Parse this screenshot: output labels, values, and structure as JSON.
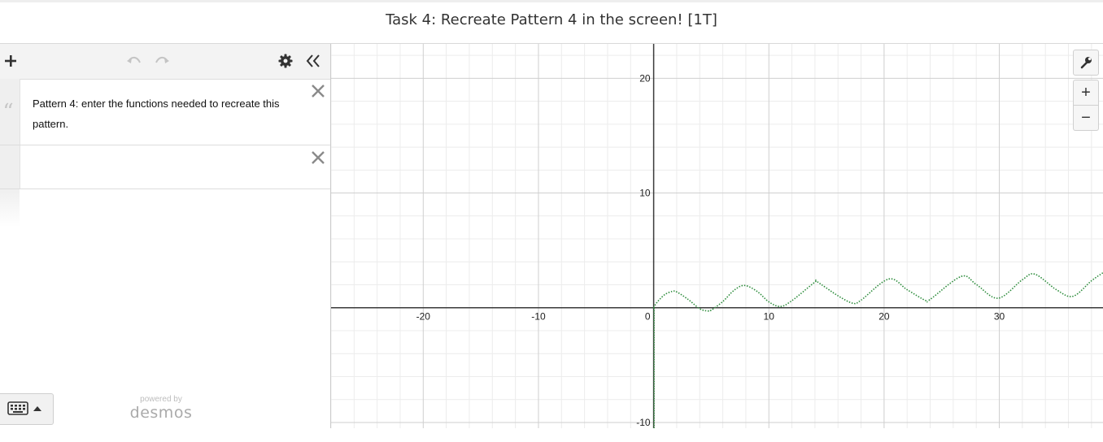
{
  "page": {
    "title": "Task 4: Recreate Pattern 4 in the screen! [1T]"
  },
  "toolbar": {
    "add_icon": "plus-icon",
    "undo_icon": "undo-icon",
    "redo_icon": "redo-icon",
    "settings_icon": "gear-icon",
    "collapse_icon": "double-chevron-left-icon"
  },
  "expressions": [
    {
      "type": "note",
      "text": "Pattern 4: enter the functions needed to recreate this pattern."
    },
    {
      "type": "expression",
      "value": ""
    }
  ],
  "footer": {
    "keyboard_icon": "keyboard-icon",
    "powered_by": "powered by",
    "brand": "desmos"
  },
  "graph_controls": {
    "settings_icon": "wrench-icon",
    "zoom_in_label": "+",
    "zoom_out_label": "−"
  },
  "chart_data": {
    "type": "line",
    "xlim": [
      -28,
      39
    ],
    "ylim": [
      -10.5,
      23
    ],
    "x_ticks": [
      -20,
      -10,
      0,
      10,
      20,
      30
    ],
    "y_ticks": [
      -10,
      10,
      20
    ],
    "x_tick_labels": [
      "-20",
      "-10",
      "0",
      "10",
      "20",
      "30"
    ],
    "y_tick_labels": [
      "-10",
      "10",
      "20"
    ],
    "grid": true,
    "series": [
      {
        "style": "dotted",
        "color": "#2d8c3c",
        "description_formula": "y = sqrt(x)/3 + sin(x)",
        "x": [
          0,
          0.05,
          0.2,
          0.5,
          1,
          1.6,
          2,
          3,
          4,
          4.7,
          5,
          6,
          7,
          7.9,
          9,
          10,
          11,
          12,
          14,
          14.2,
          16,
          17.3,
          18,
          20.4,
          22,
          23.6,
          24,
          26.7,
          28,
          29.9,
          32,
          33.1,
          35,
          36.4,
          38,
          39
        ],
        "y": [
          0,
          0.12,
          0.35,
          0.71,
          1.17,
          1.42,
          1.38,
          0.72,
          -0.09,
          -0.28,
          -0.21,
          0.54,
          1.54,
          1.94,
          1.41,
          0.51,
          0.11,
          0.62,
          2.24,
          2.26,
          1.04,
          0.39,
          0.66,
          2.5,
          1.57,
          0.63,
          0.73,
          2.73,
          2.03,
          0.83,
          2.44,
          2.92,
          1.54,
          1.0,
          2.35,
          3.05
        ]
      }
    ]
  }
}
